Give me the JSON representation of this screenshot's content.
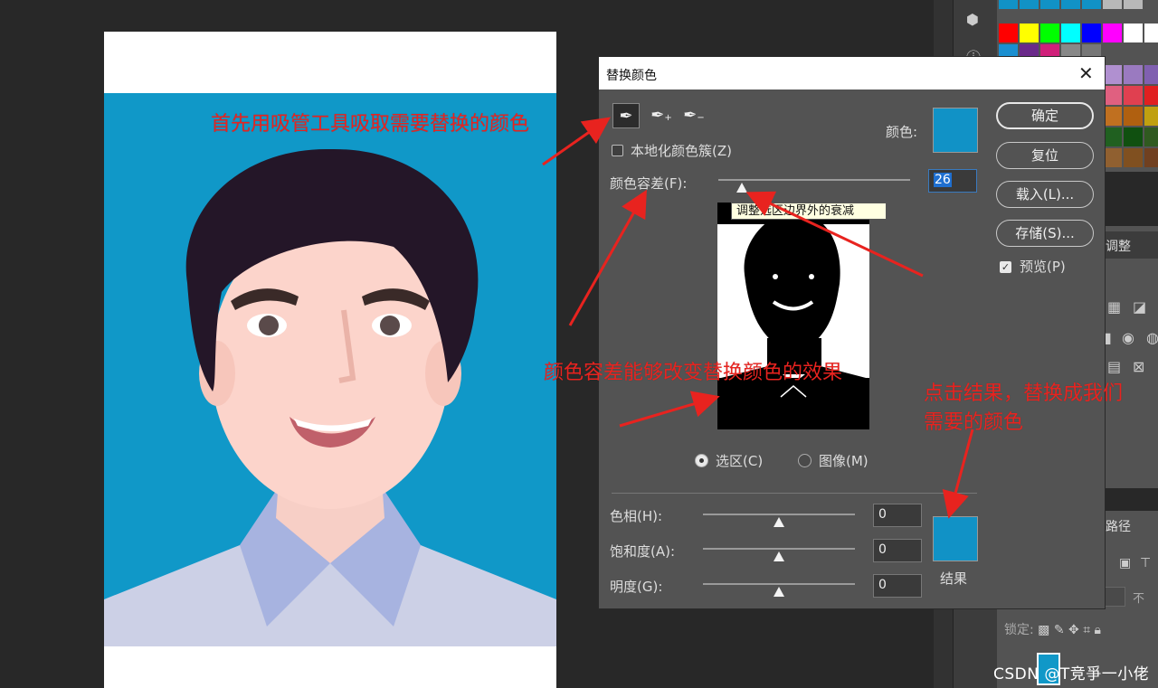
{
  "dialog": {
    "title": "替换颜色",
    "localized_label": "本地化颜色簇(Z)",
    "color_label": "颜色:",
    "fuzziness_label": "颜色容差(F):",
    "fuzziness_value": "26",
    "tooltip": "调整选区边界外的衰减",
    "selection_label": "选区(C)",
    "image_label": "图像(M)",
    "hue_label": "色相(H):",
    "hue_value": "0",
    "saturation_label": "饱和度(A):",
    "saturation_value": "0",
    "lightness_label": "明度(G):",
    "lightness_value": "0",
    "result_label": "结果",
    "buttons": {
      "ok": "确定",
      "reset": "复位",
      "load": "载入(L)...",
      "save": "存储(S)..."
    },
    "preview_label": "预览(P)",
    "sample_color": "#1192c6",
    "result_color": "#1192c6"
  },
  "annotations": {
    "step1": "首先用吸管工具吸取需要替换的颜色",
    "step2": "颜色容差能够改变替换颜色的效果",
    "step3_line1": "点击结果，替换成我们",
    "step3_line2": "需要的颜色",
    "color": "#e8231f"
  },
  "panels": {
    "adjustments_tab": "调整",
    "paths_tab": "路径",
    "lock_label": "锁定:"
  },
  "watermark": "CSDN @T竞爭一小佬",
  "icons": [
    "eyedropper-icon",
    "eyedropper-plus-icon",
    "eyedropper-minus-icon",
    "close-icon",
    "checkbox-icon"
  ]
}
